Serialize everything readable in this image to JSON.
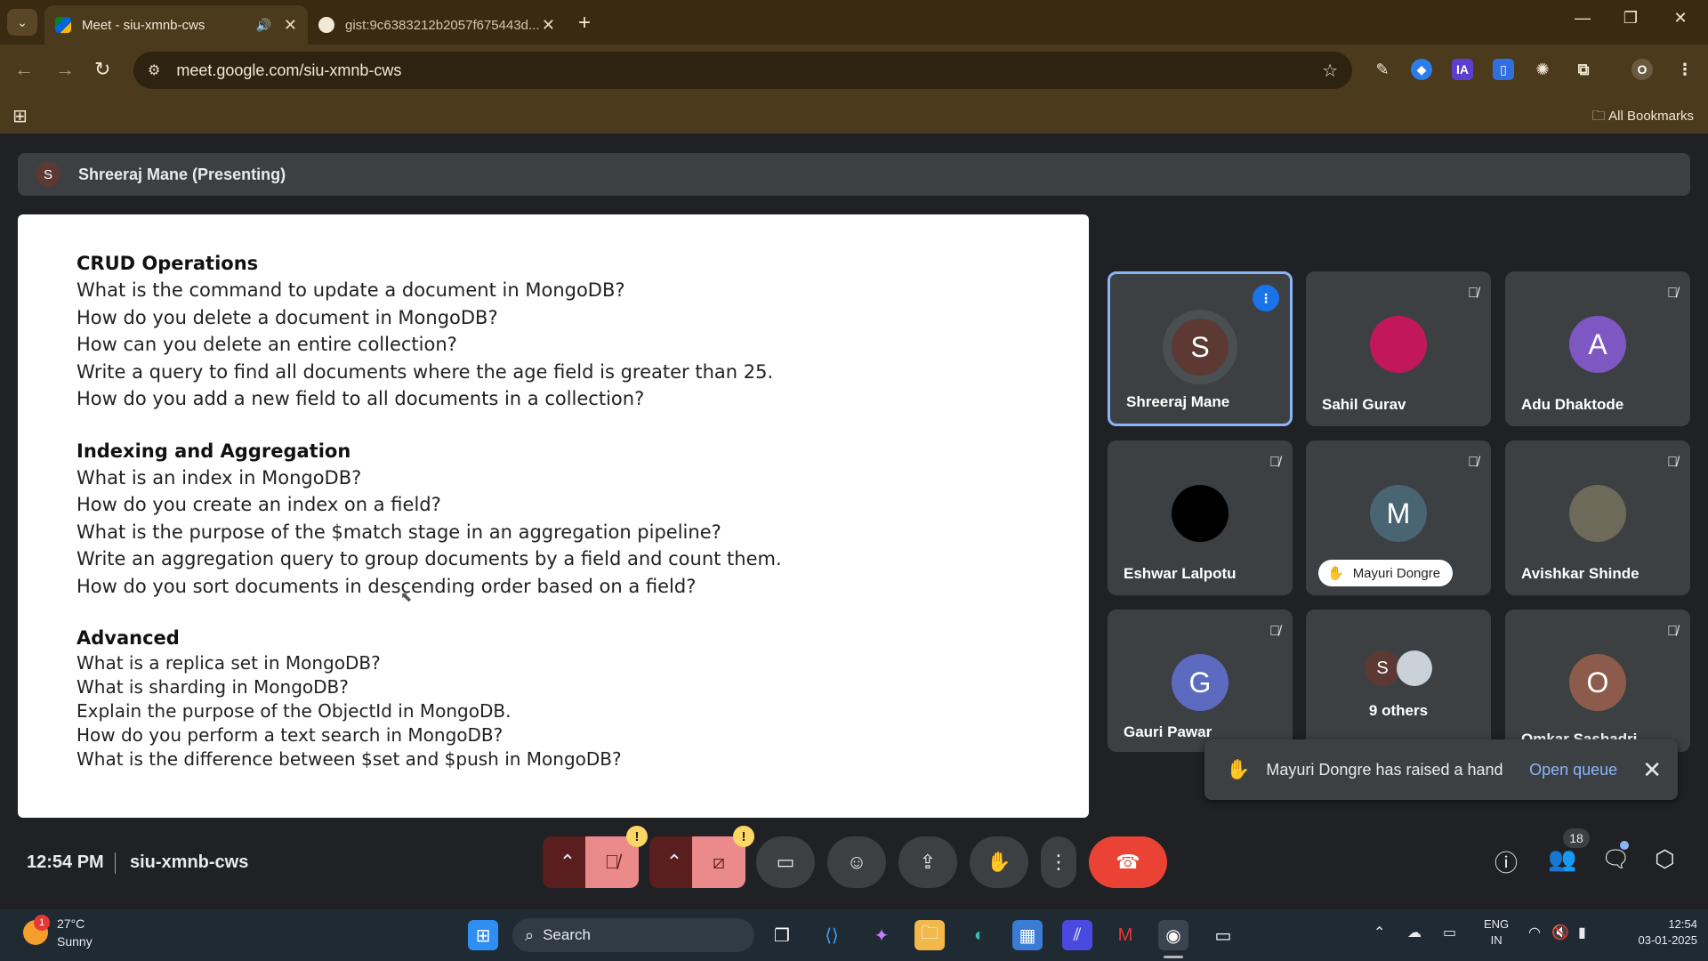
{
  "browser": {
    "tabs": [
      {
        "title": "Meet - siu-xmnb-cws",
        "active": true
      },
      {
        "title": "gist:9c6383212b2057f675443d..."
      }
    ],
    "url": "meet.google.com/siu-xmnb-cws",
    "profile_initial": "O",
    "bookmarks_label": "All Bookmarks",
    "extensions": [
      "IA"
    ]
  },
  "meet": {
    "presenter_banner": "Shreeraj Mane (Presenting)",
    "presenter_initial": "S",
    "slide": {
      "sections": [
        {
          "heading": "CRUD Operations",
          "questions": [
            "What is the command to update a document in MongoDB?",
            "How do you delete a document in MongoDB?",
            "How can you delete an entire collection?",
            "Write a query to find all documents where the age field is greater than 25.",
            "How do you add a new field to all documents in a collection?"
          ]
        },
        {
          "heading": "Indexing and Aggregation",
          "questions": [
            "What is an index in MongoDB?",
            "How do you create an index on a field?",
            "What is the purpose of the $match stage in an aggregation pipeline?",
            "Write an aggregation query to group documents by a field and count them.",
            "How do you sort documents in descending order based on a field?"
          ]
        },
        {
          "heading": "Advanced",
          "questions": [
            "What is a replica set in MongoDB?",
            "What is sharding in MongoDB?",
            "Explain the purpose of the ObjectId in MongoDB.",
            "How do you perform a text search in MongoDB?",
            "What is the difference between $set and $push in MongoDB?"
          ]
        }
      ]
    },
    "participants": [
      {
        "name": "Shreeraj Mane",
        "initial": "S",
        "color": "#5c3a33",
        "speaking": true
      },
      {
        "name": "Sahil Gurav",
        "initial": "",
        "color": "#c2185b",
        "muted": true
      },
      {
        "name": "Adu Dhaktode",
        "initial": "A",
        "color": "#7e57c2",
        "muted": true
      },
      {
        "name": "Eshwar Lalpotu",
        "initial": "",
        "color": "#000000",
        "muted": true
      },
      {
        "name": "Mayuri Dongre",
        "initial": "M",
        "color": "#4a6572",
        "muted": true,
        "hand_raised": true
      },
      {
        "name": "Avishkar Shinde",
        "initial": "",
        "color": "#6d6a5a",
        "muted": true
      },
      {
        "name": "Gauri Pawar",
        "initial": "G",
        "color": "#5c6bc0",
        "muted": true
      },
      {
        "name": "9 others",
        "initial": "S",
        "color": "#5c3a33"
      },
      {
        "name": "Omkar Sashadri",
        "initial": "O",
        "color": "#8d5b4c",
        "muted": true
      }
    ],
    "toast": {
      "message": "Mayuri Dongre has raised a hand",
      "action": "Open queue"
    },
    "controls": {
      "time": "12:54 PM",
      "meeting_code": "siu-xmnb-cws",
      "participant_count": "18"
    }
  },
  "taskbar": {
    "weather_temp": "27°C",
    "weather_cond": "Sunny",
    "weather_badge": "1",
    "search_label": "Search",
    "lang_line1": "ENG",
    "lang_line2": "IN",
    "time": "12:54",
    "date": "03-01-2025"
  },
  "colors": {
    "accent": "#8ab4f8",
    "hangup": "#ea4335",
    "chrome_bg": "#3a2a12"
  }
}
